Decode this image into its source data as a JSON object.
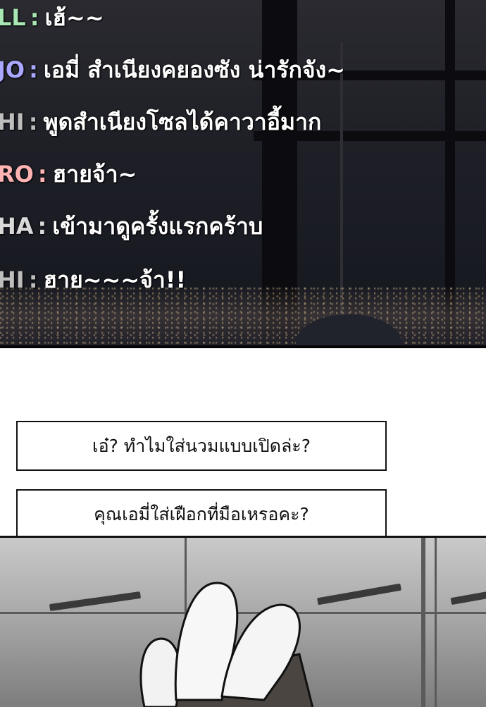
{
  "chat": [
    {
      "name": "LL",
      "color": "#a8e6b4",
      "message": "เฮ้~~"
    },
    {
      "name": "JO",
      "color": "#a9a7ff",
      "message": "เอมี่ สำเนียงคยองซัง น่ารักจัง~"
    },
    {
      "name": "HI",
      "color": "#bdbdbd",
      "message": "พูดสำเนียงโซลได้คาวาอี้มาก"
    },
    {
      "name": "RO",
      "color": "#ffb3b3",
      "message": "ฮายจ้า~"
    },
    {
      "name": "HA",
      "color": "#d9d9d9",
      "message": "เข้ามาดูครั้งแรกคร้าบ"
    },
    {
      "name": "HI",
      "color": "#bdbdbd",
      "message": "ฮาย~~~จ้า!!"
    }
  ],
  "separator": ":",
  "dialogues": [
    {
      "text": "เอ๋? ทำไมใส่นวมแบบเปิดล่ะ?"
    },
    {
      "text": "คุณเอมี่ใส่เฝือกที่มือเหรอคะ?"
    }
  ]
}
